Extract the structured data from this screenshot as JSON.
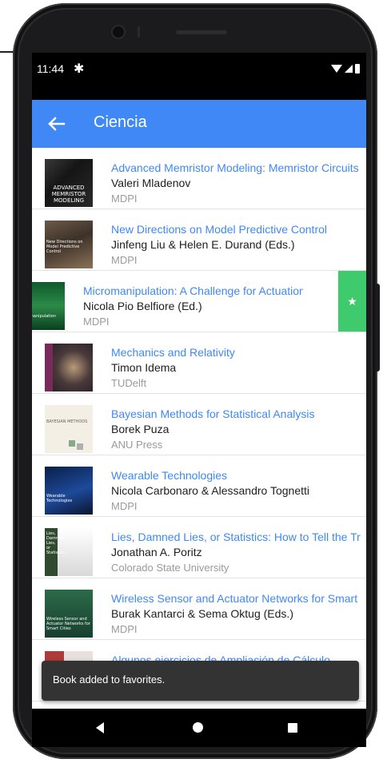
{
  "status_bar": {
    "time": "11:44",
    "settings_icon": "gear-icon",
    "wifi_icon": "wifi-icon",
    "signal_icon": "signal-icon",
    "battery_icon": "battery-icon"
  },
  "app_bar": {
    "title": "Ciencia",
    "back_icon": "arrow-left-icon",
    "color": "#3f88f5"
  },
  "books": [
    {
      "title": "Advanced Memristor Modeling: Memristor Circuits and Networks",
      "author": "Valeri Mladenov",
      "publisher": "MDPI",
      "cover_text": "ADVANCED MEMRISTOR MODELING"
    },
    {
      "title": "New Directions on Model Predictive Control",
      "author": "Jinfeng Liu & Helen E. Durand (Eds.)",
      "publisher": "MDPI",
      "cover_text": "New Directions on Model Predictive Control"
    },
    {
      "title": "Micromanipulation: A Challenge for Actuation",
      "author": "Nicola Pio Belfiore (Ed.)",
      "publisher": "MDPI",
      "cover_text": "micromanipulation",
      "swiped": true
    },
    {
      "title": "Mechanics and Relativity",
      "author": "Timon Idema",
      "publisher": "TUDelft",
      "cover_text": ""
    },
    {
      "title": "Bayesian Methods for Statistical Analysis",
      "author": "Borek Puza",
      "publisher": "ANU Press",
      "cover_text": "BAYESIAN METHODS"
    },
    {
      "title": "Wearable Technologies",
      "author": "Nicola Carbonaro & Alessandro Tognetti",
      "publisher": "MDPI",
      "cover_text": "Wearable Technologies"
    },
    {
      "title": "Lies, Damned Lies, or Statistics: How to Tell the Truth with Statistics",
      "author": "Jonathan A. Poritz",
      "publisher": "Colorado State University",
      "cover_text": "Lies, Damned Lies, or Statistics"
    },
    {
      "title": "Wireless Sensor and Actuator Networks for Smart Cities",
      "author": "Burak Kantarci & Sema Oktug (Eds.)",
      "publisher": "MDPI",
      "cover_text": "Wireless Sensor and Actuator Networks for Smart Cities"
    },
    {
      "title": "Algunos ejercicios de Ampliación de Cálculo",
      "author": "",
      "publisher": "",
      "cover_text": ""
    }
  ],
  "favorite_action": {
    "icon": "star-icon",
    "color": "#3fca6d",
    "glyph": "★"
  },
  "snackbar": {
    "message": "Book added to favorites."
  },
  "nav_bar": {
    "back_icon": "nav-back-icon",
    "home_icon": "nav-home-icon",
    "recents_icon": "nav-recents-icon"
  }
}
